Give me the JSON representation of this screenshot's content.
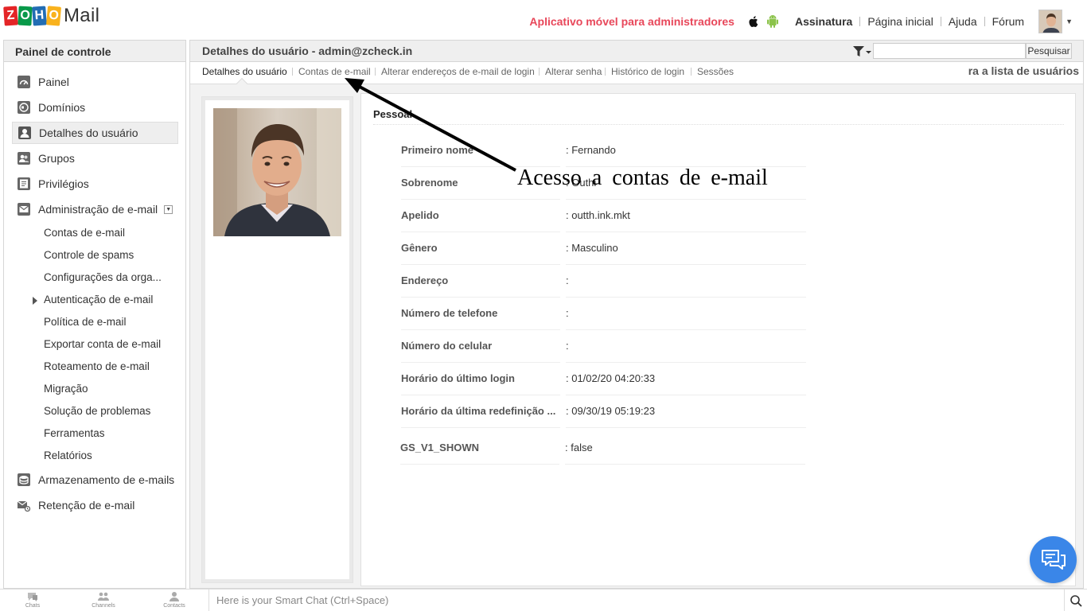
{
  "header": {
    "logo_letters": [
      "Z",
      "O",
      "H",
      "O"
    ],
    "logo_colors": [
      "#e42527",
      "#089949",
      "#226db4",
      "#f9b21d"
    ],
    "logo_mail": "Mail",
    "mobile_app_link": "Aplicativo móvel para administradores",
    "links": [
      "Assinatura",
      "Página inicial",
      "Ajuda",
      "Fórum"
    ]
  },
  "sidebar": {
    "title": "Painel de controle",
    "items": [
      {
        "label": "Painel",
        "icon": "dashboard-icon"
      },
      {
        "label": "Domínios",
        "icon": "globe-icon"
      },
      {
        "label": "Detalhes do usuário",
        "icon": "user-icon",
        "active": true
      },
      {
        "label": "Grupos",
        "icon": "group-icon"
      },
      {
        "label": "Privilégios",
        "icon": "privileges-icon"
      },
      {
        "label": "Administração de e-mail",
        "icon": "mail-admin-icon",
        "expanded": true
      }
    ],
    "subitems": [
      "Contas de e-mail",
      "Controle de spams",
      "Configurações da orga...",
      "Autenticação de e-mail",
      "Política de e-mail",
      "Exportar conta de e-mail",
      "Roteamento de e-mail",
      "Migração",
      "Solução de problemas",
      "Ferramentas",
      "Relatórios"
    ],
    "bottom_items": [
      {
        "label": "Armazenamento de e-mails",
        "icon": "storage-icon"
      },
      {
        "label": "Retenção de e-mail",
        "icon": "retention-icon"
      }
    ]
  },
  "main": {
    "title": "Detalhes do usuário - admin@zcheck.in",
    "search_button": "Pesquisar",
    "search_value": "",
    "tabs": [
      {
        "label": "Detalhes do usuário",
        "active": true
      },
      {
        "label": "Contas de e-mail"
      },
      {
        "label": "Alterar endereços de e-mail de login"
      },
      {
        "label": "Alterar senha"
      },
      {
        "label": "Histórico de login"
      },
      {
        "label": "Sessões"
      }
    ],
    "back_link": "ra a lista de usuários",
    "section_title": "Pessoal",
    "fields": [
      {
        "label": "Primeiro nome",
        "value": ": Fernando"
      },
      {
        "label": "Sobrenome",
        "value": ": Outhi"
      },
      {
        "label": "Apelido",
        "value": ": outth.ink.mkt"
      },
      {
        "label": "Gênero",
        "value": ": Masculino"
      },
      {
        "label": "Endereço",
        "value": ":"
      },
      {
        "label": "Número de telefone",
        "value": ":"
      },
      {
        "label": "Número do celular",
        "value": ":"
      },
      {
        "label": "Horário do último login",
        "value": ": 01/02/20 04:20:33"
      },
      {
        "label": "Horário da última redefinição ...",
        "value": ": 09/30/19 05:19:23"
      },
      {
        "label": "GS_V1_SHOWN",
        "value": ": false"
      }
    ]
  },
  "annotation": {
    "text": "Acesso a contas de e-mail"
  },
  "bottombar": {
    "items": [
      "Chats",
      "Channels",
      "Contacts"
    ],
    "smartchat_placeholder": "Here is your Smart Chat (Ctrl+Space)"
  }
}
